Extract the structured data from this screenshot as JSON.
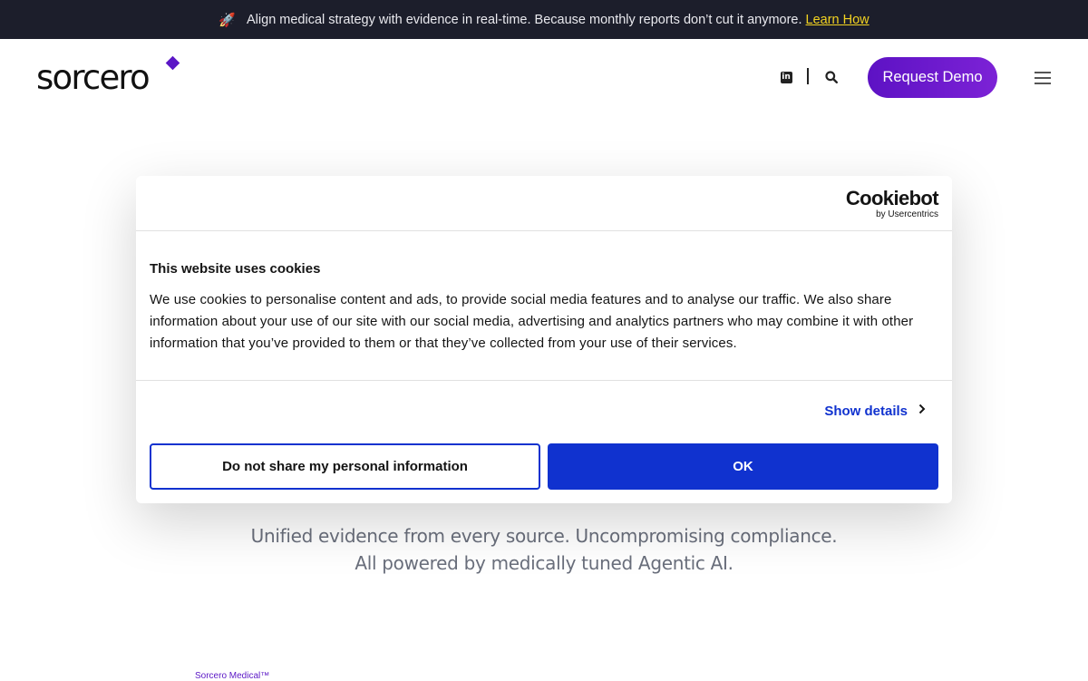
{
  "announcement": {
    "icon": "rocket-icon",
    "text": "Align medical strategy with evidence in real-time. Because monthly reports don’t cut it anymore.",
    "link": "Learn How",
    "link_color": "#f3d321"
  },
  "header": {
    "logo": "sorcero",
    "brand_color": "#5b17c6",
    "icons": [
      "linkedin-icon",
      "search-icon",
      "hamburger-menu-icon"
    ],
    "demo_button": "Request Demo"
  },
  "hero": {
    "tagline_line1": "Unified evidence from every source. Uncompromising compliance.",
    "tagline_line2": "All powered by medically tuned Agentic AI.",
    "product_label": "Sorcero Medical™"
  },
  "cookie_dialog": {
    "brand_main": "Cookiebot",
    "brand_sub": "by Usercentrics",
    "title": "This website uses cookies",
    "body": "We use cookies to personalise content and ads, to provide social media features and to analyse our traffic. We also share information about your use of our site with our social media, advertising and analytics partners who may combine it with other information that you’ve provided to them or that they’ve collected from your use of their services.",
    "show_details": "Show details",
    "deny_button": "Do not share my personal information",
    "ok_button": "OK",
    "accent_color": "#1032cf"
  }
}
